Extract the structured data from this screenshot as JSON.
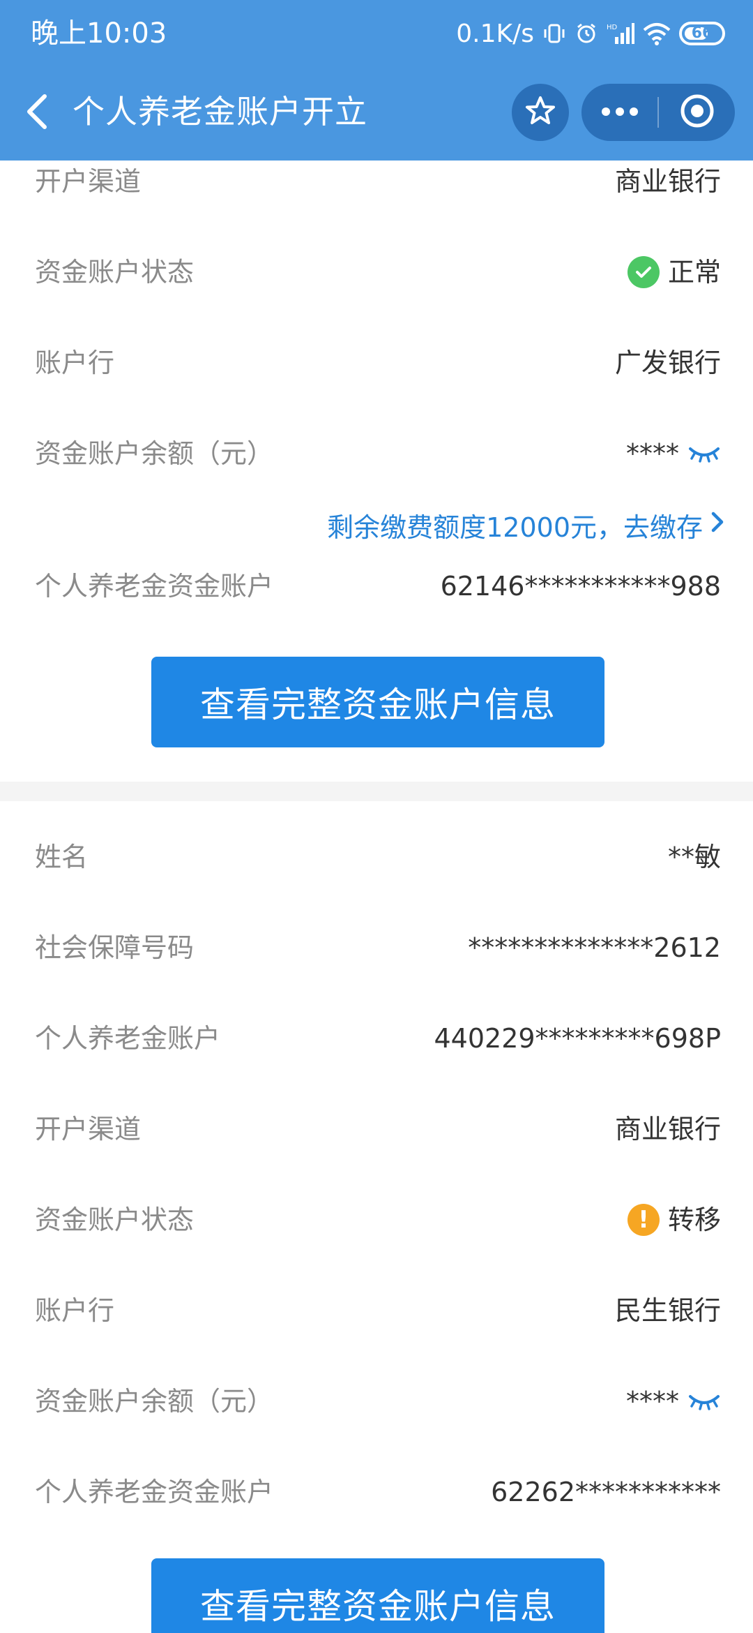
{
  "status_bar": {
    "time": "晚上10:03",
    "net_speed": "0.1K/s",
    "battery": "66"
  },
  "navbar": {
    "title": "个人养老金账户开立"
  },
  "account1": {
    "channel": {
      "label": "开户渠道",
      "value": "商业银行"
    },
    "status": {
      "label": "资金账户状态",
      "value": "正常"
    },
    "bank": {
      "label": "账户行",
      "value": "广发银行"
    },
    "balance": {
      "label": "资金账户余额（元）",
      "value": "****"
    },
    "quota_link": "剩余缴费额度12000元，去缴存",
    "fund_account": {
      "label": "个人养老金资金账户",
      "value": "62146***********988"
    },
    "button": "查看完整资金账户信息"
  },
  "account2": {
    "name": {
      "label": "姓名",
      "value": "**敏"
    },
    "social_security": {
      "label": "社会保障号码",
      "value": "**************2612"
    },
    "pension_account": {
      "label": "个人养老金账户",
      "value": "440229*********698P"
    },
    "channel": {
      "label": "开户渠道",
      "value": "商业银行"
    },
    "status": {
      "label": "资金账户状态",
      "value": "转移"
    },
    "bank": {
      "label": "账户行",
      "value": "民生银行"
    },
    "balance": {
      "label": "资金账户余额（元）",
      "value": "****"
    },
    "fund_account": {
      "label": "个人养老金资金账户",
      "value": "62262***********"
    },
    "button": "查看完整资金账户信息"
  },
  "colors": {
    "header": "#4A97E0",
    "primary": "#1F87E5",
    "ok": "#4CC764",
    "warn": "#F6A623",
    "link": "#2683D8"
  }
}
